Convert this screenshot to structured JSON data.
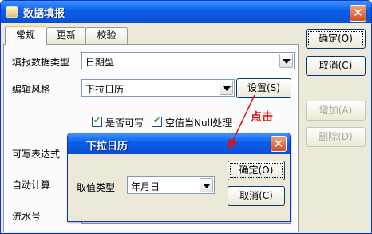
{
  "window": {
    "title": "数据填报"
  },
  "tabs": [
    {
      "label": "常规"
    },
    {
      "label": "更新"
    },
    {
      "label": "校验"
    }
  ],
  "form": {
    "data_type_label": "填报数据类型",
    "data_type_value": "日期型",
    "edit_style_label": "编辑风格",
    "edit_style_value": "下拉日历",
    "settings_button": "设置(S)",
    "writable_label": "是否可写",
    "empty_as_null_label": "空值当Null处理",
    "writable_expr_label": "可写表达式",
    "auto_calc_label": "自动计算",
    "serial_label": "流水号"
  },
  "side_buttons": {
    "ok": "确定(O)",
    "cancel": "取消(C)",
    "add": "增加(A)",
    "delete": "删除(D)"
  },
  "annotation": "点击",
  "popup": {
    "title": "下拉日历",
    "value_type_label": "取值类型",
    "value_type_value": "年月日",
    "ok": "确定(O)",
    "cancel": "取消(C)"
  },
  "colors": {
    "title_bar": "#0a5de8",
    "annotation": "#e01010"
  }
}
